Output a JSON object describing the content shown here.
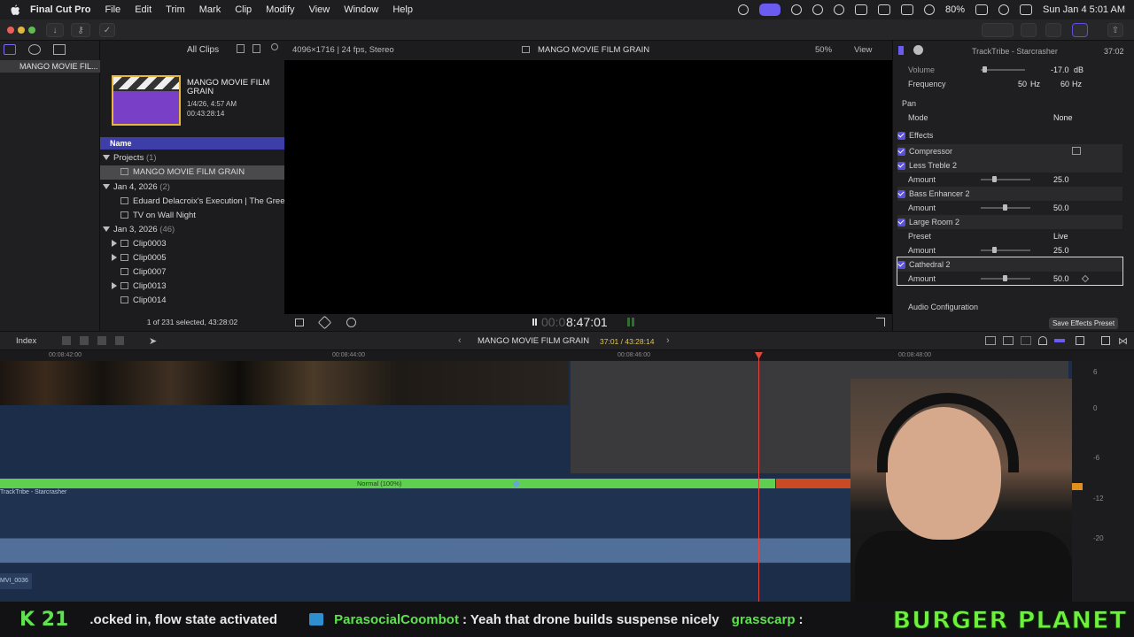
{
  "menubar": {
    "app": "Final Cut Pro",
    "items": [
      "File",
      "Edit",
      "Trim",
      "Mark",
      "Clip",
      "Modify",
      "View",
      "Window",
      "Help"
    ],
    "battery": "80%",
    "datetime": "Sun Jan 4  5:01 AM"
  },
  "browser": {
    "filter": "All Clips",
    "event": "MANGO MOVIE FIL...",
    "thumb_title": "MANGO MOVIE FILM GRAIN",
    "thumb_date": "1/4/26, 4:57 AM",
    "thumb_duration": "00:43:28:14",
    "column_name": "Name",
    "status": "1 of 231 selected, 43:28:02",
    "groups": [
      {
        "label": "Projects",
        "count": "(1)",
        "items": [
          "MANGO MOVIE FILM GRAIN"
        ]
      },
      {
        "label": "Jan 4, 2026",
        "count": "(2)",
        "items": [
          "Eduard Delacroix's Execution  |  The Green",
          "TV on Wall Night"
        ]
      },
      {
        "label": "Jan 3, 2026",
        "count": "(46)",
        "items": [
          "Clip0003",
          "Clip0005",
          "Clip0007",
          "Clip0013",
          "Clip0014"
        ]
      }
    ]
  },
  "viewer": {
    "format": "4096×1716 | 24 fps, Stereo",
    "title": "MANGO MOVIE FILM GRAIN",
    "zoom": "50%",
    "view_label": "View",
    "timecode_dim": "00:0",
    "timecode": "8:47:01"
  },
  "inspector": {
    "title": "TrackTribe - Starcrasher",
    "duration": "37:02",
    "volume_label": "Volume",
    "volume_value": "-17.0",
    "volume_unit": "dB",
    "frequency_label": "Frequency",
    "freq1": "50",
    "freq2": "60",
    "freq_unit": "Hz",
    "pan_label": "Pan",
    "mode_label": "Mode",
    "mode_value": "None",
    "effects_label": "Effects",
    "effects": [
      {
        "name": "Compressor"
      },
      {
        "name": "Less Treble 2",
        "param": "Amount",
        "value": "25.0",
        "level": 0.25
      },
      {
        "name": "Bass Enhancer 2",
        "param": "Amount",
        "value": "50.0",
        "level": 0.5
      },
      {
        "name": "Large Room 2",
        "preset_label": "Preset",
        "preset": "Live",
        "param": "Amount",
        "value": "25.0",
        "level": 0.25
      },
      {
        "name": "Cathedral 2",
        "param": "Amount",
        "value": "50.0",
        "level": 0.5
      }
    ],
    "audio_config": "Audio Configuration",
    "save_preset": "Save Effects Preset"
  },
  "timeline": {
    "index_label": "Index",
    "project": "MANGO MOVIE FILM GRAIN",
    "position": "37:01 / 43:28:14",
    "ticks": [
      "00:08:42:00",
      "00:08:44:00",
      "00:08:46:00",
      "00:08:48:00"
    ],
    "audio_role": "Normal (100%)",
    "audio_clip": "TrackTribe - Starcrasher",
    "clip_label": "MVI_0036",
    "meter_labels": [
      "6",
      "0",
      "-6",
      "-12",
      "-20"
    ]
  },
  "overlay": {
    "badge_letter": "K",
    "badge_num": "21",
    "msg1": ".ocked in, flow state activated",
    "user": "ParasocialCoombot",
    "msg2": ": Yeah that drone builds suspense nicely",
    "user2": "grasscarp",
    "msg3": ":",
    "brand": "BURGER PLANET"
  },
  "colors": {
    "accent": "#5a4fe0",
    "audio_green": "#5fcf4f",
    "playhead": "#e2453c",
    "brand_green": "#6ff03a"
  }
}
